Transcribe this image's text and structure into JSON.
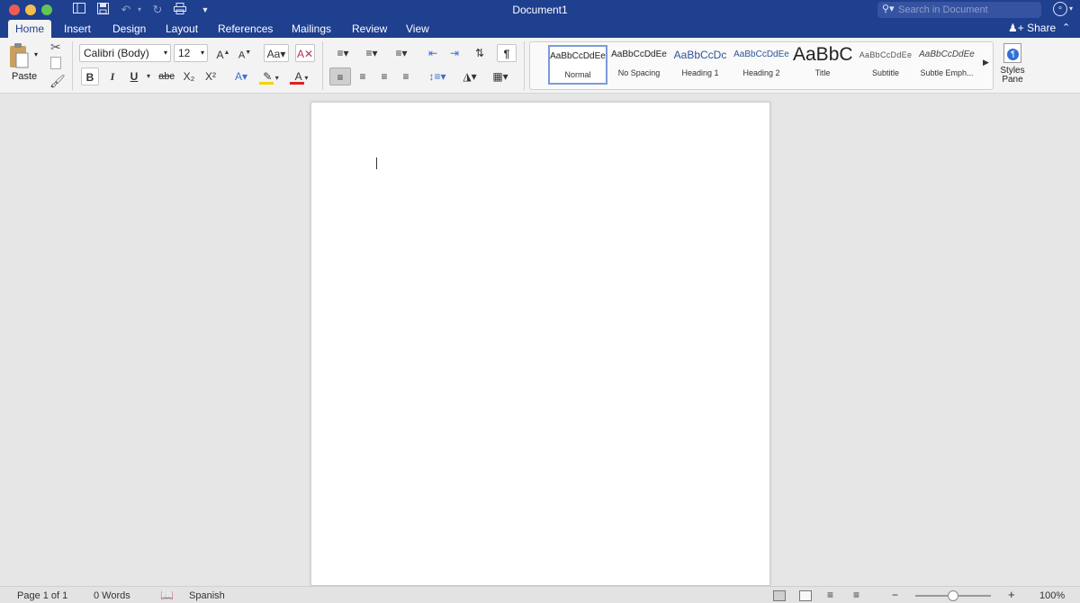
{
  "window": {
    "title": "Document1"
  },
  "colors": {
    "titlebar": "#1f3f8f",
    "close": "#ed5d55",
    "minimize": "#f4bd4f",
    "maximize": "#61c454",
    "highlight": "#f3d400",
    "font_color": "#e02020"
  },
  "quick_access": {
    "icons": [
      "sidebar-icon",
      "save-icon",
      "undo-icon",
      "redo-icon",
      "print-icon",
      "customize-icon"
    ]
  },
  "search": {
    "placeholder": "Search in Document"
  },
  "tabs": [
    "Home",
    "Insert",
    "Design",
    "Layout",
    "References",
    "Mailings",
    "Review",
    "View"
  ],
  "share_label": "Share",
  "ribbon": {
    "paste_label": "Paste",
    "font_name": "Calibri (Body)",
    "font_size": "12",
    "bold": "B",
    "italic": "I",
    "underline": "U",
    "strike": "abc",
    "subscript": "X₂",
    "superscript": "X²",
    "styles": [
      {
        "preview": "AaBbCcDdEe",
        "name": "Normal"
      },
      {
        "preview": "AaBbCcDdEe",
        "name": "No Spacing"
      },
      {
        "preview": "AaBbCcDc",
        "name": "Heading 1"
      },
      {
        "preview": "AaBbCcDdEe",
        "name": "Heading 2"
      },
      {
        "preview": "AaBbC",
        "name": "Title"
      },
      {
        "preview": "AaBbCcDdEe",
        "name": "Subtitle"
      },
      {
        "preview": "AaBbCcDdEe",
        "name": "Subtle Emph..."
      }
    ],
    "styles_pane_label": "Styles\nPane"
  },
  "status": {
    "page": "Page 1 of 1",
    "words": "0 Words",
    "language": "Spanish",
    "zoom": "100%",
    "zoom_level": 1.0
  }
}
